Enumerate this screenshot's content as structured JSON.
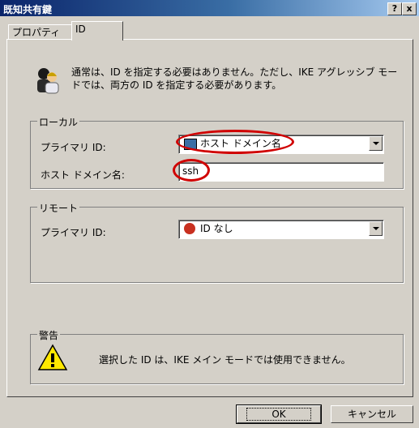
{
  "window": {
    "title": "既知共有鍵",
    "help_button": "?",
    "close_button": "x"
  },
  "tabs": [
    {
      "label": "プロパティ"
    },
    {
      "label": "ID"
    }
  ],
  "intro": {
    "text": "通常は、ID を指定する必要はありません。ただし、IKE アグレッシブ モードでは、両方の ID を指定する必要があります。",
    "icon": "users-icon"
  },
  "local": {
    "legend": "ローカル",
    "primary_id_label": "プライマリ ID:",
    "primary_id_value": "ホスト ドメイン名",
    "host_domain_label": "ホスト ドメイン名:",
    "host_domain_value": "ssh"
  },
  "remote": {
    "legend": "リモート",
    "primary_id_label": "プライマリ ID:",
    "primary_id_value": "ID なし"
  },
  "warning": {
    "legend": "警告",
    "text": "選択した ID は、IKE メイン モードでは使用できません。",
    "icon": "warning-icon"
  },
  "buttons": {
    "ok": "OK",
    "cancel": "キャンセル"
  },
  "colors": {
    "titlebar": "#0a246a",
    "highlight": "#d00000",
    "face": "#d4d0c8"
  }
}
